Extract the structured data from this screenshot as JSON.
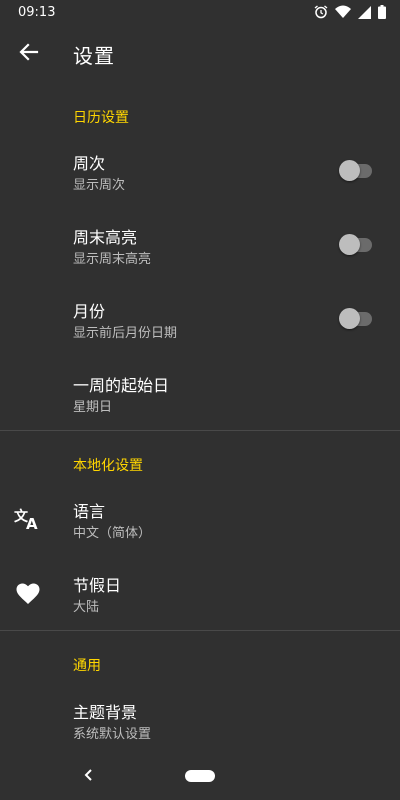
{
  "status_bar": {
    "time": "09:13"
  },
  "app_bar": {
    "title": "设置"
  },
  "sections": {
    "calendar": {
      "header": "日历设置",
      "items": [
        {
          "title": "周次",
          "subtitle": "显示周次",
          "switch_on": false
        },
        {
          "title": "周末高亮",
          "subtitle": "显示周末高亮",
          "switch_on": false
        },
        {
          "title": "月份",
          "subtitle": "显示前后月份日期",
          "switch_on": false
        },
        {
          "title": "一周的起始日",
          "subtitle": "星期日"
        }
      ]
    },
    "localization": {
      "header": "本地化设置",
      "items": [
        {
          "title": "语言",
          "subtitle": "中文（简体）",
          "icon": "translate-icon"
        },
        {
          "title": "节假日",
          "subtitle": "大陆",
          "icon": "heart-icon"
        }
      ]
    },
    "general": {
      "header": "通用",
      "items": [
        {
          "title": "主题背景",
          "subtitle": "系统默认设置"
        }
      ]
    }
  },
  "colors": {
    "background": "#303030",
    "accent": "#ffd600",
    "secondary_text": "#bdbdbd",
    "switch_track_off": "#6b6b6b",
    "switch_thumb_off": "#bdbdbd"
  }
}
